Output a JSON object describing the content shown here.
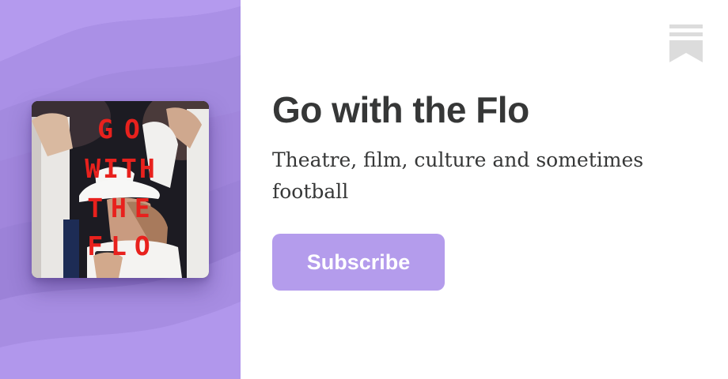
{
  "publication": {
    "title": "Go with the Flo",
    "description": "Theatre, film, culture and sometimes football"
  },
  "cover": {
    "lines": [
      "GO",
      "WITH",
      "THE",
      "FLO"
    ],
    "text_color": "#e8211d"
  },
  "actions": {
    "subscribe_label": "Subscribe"
  },
  "brand": {
    "icon": "substack-bookmark-icon",
    "icon_color": "#dcdcdc"
  },
  "colors": {
    "panel": "#a58ce0",
    "button": "#b49cec",
    "text": "#363737",
    "background": "#ffffff"
  }
}
